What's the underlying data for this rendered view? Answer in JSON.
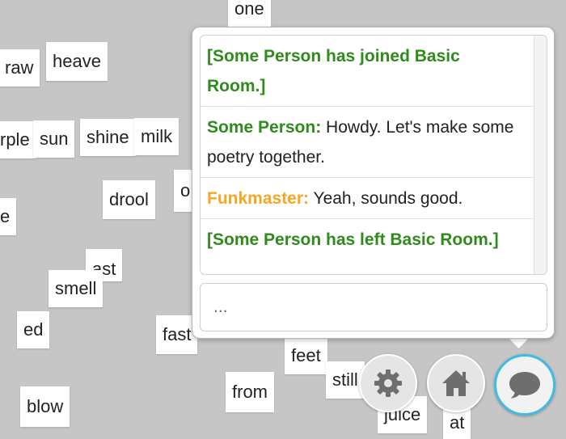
{
  "tiles": [
    "one",
    "raw",
    "heave",
    "rple",
    "sun",
    "shine",
    "milk",
    "drool",
    "o",
    "e",
    "ast",
    "smell",
    "ed",
    "fast",
    "feet",
    "still",
    "from",
    "blow",
    "juice",
    "at"
  ],
  "chat": {
    "messages": [
      {
        "type": "system",
        "text": "[Some Person has joined Basic Room.]"
      },
      {
        "type": "user",
        "nick": "Some Person:",
        "text": " Howdy. Let's make some poetry together.",
        "color": "#2e8b1c"
      },
      {
        "type": "user",
        "nick": "Funkmaster:",
        "text": " Yeah, sounds good.",
        "color": "#f5a623"
      },
      {
        "type": "system",
        "text": "[Some Person has left Basic Room.]"
      }
    ],
    "input_placeholder": "..."
  },
  "buttons": {
    "settings_icon": "gear-icon",
    "home_icon": "home-icon",
    "chat_icon": "chat-bubble-icon",
    "chat_active_color": "#3fbbe8"
  }
}
